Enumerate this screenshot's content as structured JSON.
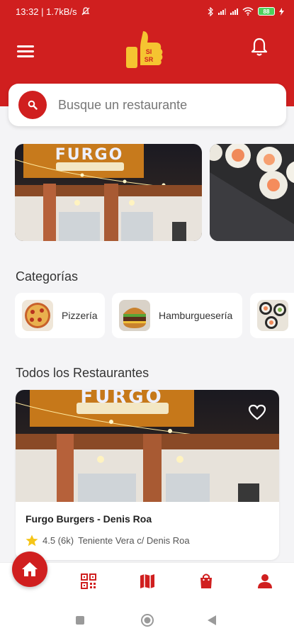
{
  "status_bar": {
    "time_speed": "13:32 | 1.7kB/s",
    "battery": "88"
  },
  "header": {
    "logo_text": "SI SR"
  },
  "search": {
    "placeholder": "Busque un restaurante"
  },
  "banners": {
    "first_sign": "FURGO"
  },
  "categories": {
    "title": "Categorías",
    "items": [
      {
        "label": "Pizzería",
        "icon": "pizza-image"
      },
      {
        "label": "Hamburguesería",
        "icon": "burger-image"
      },
      {
        "label": "",
        "icon": "sushi-image"
      }
    ]
  },
  "restaurants": {
    "title": "Todos los Restaurantes",
    "items": [
      {
        "sign": "FURGO",
        "name": "Furgo Burgers - Denis Roa",
        "rating": "4.5 (6k)",
        "address": "Teniente Vera c/ Denis Roa"
      }
    ]
  },
  "colors": {
    "brand_red": "#d01f1f",
    "logo_yellow": "#f5c431",
    "star": "#f5c518"
  }
}
